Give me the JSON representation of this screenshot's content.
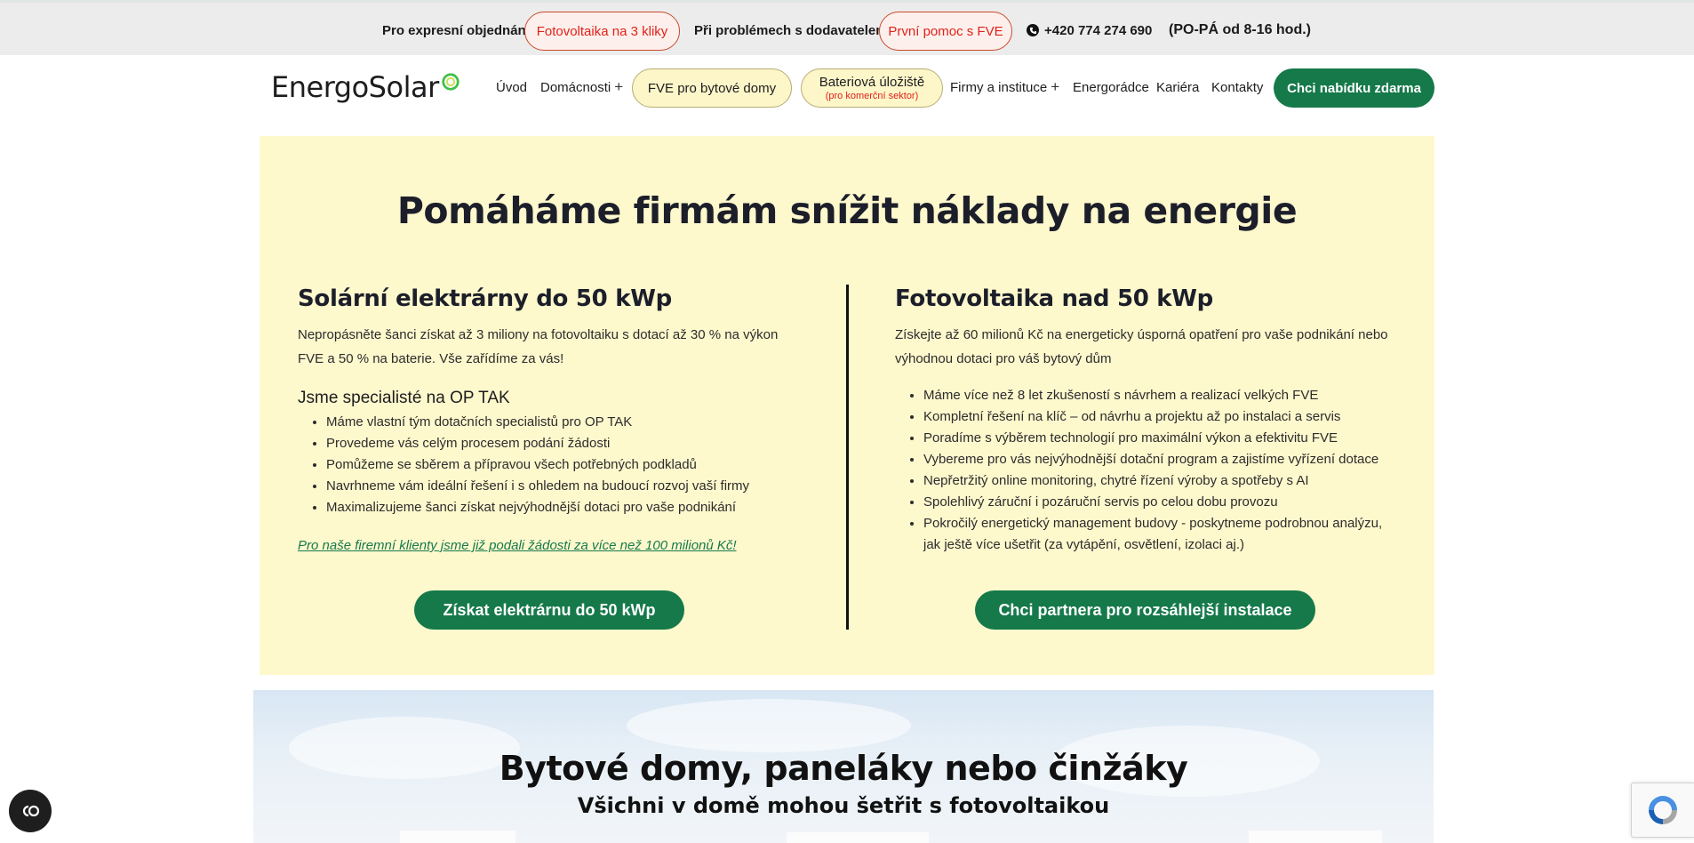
{
  "topbar": {
    "order_label": "Pro expresní objednání",
    "order_button": "Fotovoltaika na 3 kliky",
    "problem_label": "Při problémech s dodavatelem",
    "problem_button": "První pomoc s FVE",
    "phone": "+420 774 274 690",
    "hours": "(PO-PÁ od 8-16 hod.)"
  },
  "nav": {
    "logo": "EnergoSolar",
    "items": {
      "home": "Úvod",
      "households": "Domácnosti",
      "apartments": "FVE pro bytové domy",
      "battery": "Bateriová úložiště",
      "battery_sub": "(pro komerční sektor)",
      "companies": "Firmy a instituce",
      "advisory": "Energorádce",
      "career": "Kariéra",
      "contacts": "Kontakty"
    },
    "cta": "Chci nabídku zdarma"
  },
  "hero": {
    "title": "Pomáháme firmám snížit náklady na energie",
    "left": {
      "heading": "Solární elektrárny do 50 kWp",
      "text": "Nepropásněte šanci získat až 3 miliony na fotovoltaiku s dotací až 30 % na výkon FVE a 50 % na baterie. Vše zařídíme za vás!",
      "subheading": "Jsme specialisté na OP TAK",
      "bullets": [
        "Máme vlastní tým dotačních specialistů pro OP TAK",
        "Provedeme vás celým procesem podání žádosti",
        "Pomůžeme se sběrem a přípravou všech potřebných podkladů",
        "Navrhneme vám ideální řešení i s ohledem na budoucí rozvoj vaší firmy",
        "Maximalizujeme šanci získat nejvýhodnější dotaci pro vaše podnikání"
      ],
      "note": "Pro naše firemní klienty jsme již podali žádosti za více než 100 milionů Kč!",
      "button": "Získat elektrárnu do 50 kWp"
    },
    "right": {
      "heading": "Fotovoltaika nad 50 kWp",
      "text": "Získejte až 60 milionů Kč na energeticky úsporná opatření pro vaše podnikání nebo výhodnou dotaci pro váš bytový dům",
      "bullets": [
        "Máme více než 8 let zkušeností s návrhem a realizací velkých FVE",
        "Kompletní řešení na klíč – od návrhu a projektu až po instalaci a servis",
        "Poradíme s výběrem technologií pro maximální výkon a efektivitu FVE",
        "Vybereme pro vás nejvýhodnější dotační program a zajistíme vyřízení dotace",
        "Nepřetržitý online monitoring, chytré řízení výroby a spotřeby s AI",
        "Spolehlivý záruční i pozáruční servis po celou dobu provozu",
        "Pokročilý energetický management budovy - poskytneme podrobnou analýzu, jak ještě více ušetřit (za vytápění, osvětlení, izolaci aj.)"
      ],
      "button": "Chci partnera pro rozsáhlejší instalace"
    }
  },
  "section2": {
    "title": "Bytové domy, paneláky nebo činžáky",
    "subtitle": "Všichni v domě mohou šetřit s fotovoltaikou"
  },
  "colors": {
    "brand_green": "#15794a",
    "hero_bg": "#fef8cd",
    "alert_red": "#e0221b"
  },
  "icons": [
    "phone-icon",
    "logo-ring-icon",
    "plus-icon",
    "cookie-settings-icon",
    "recaptcha-icon"
  ]
}
